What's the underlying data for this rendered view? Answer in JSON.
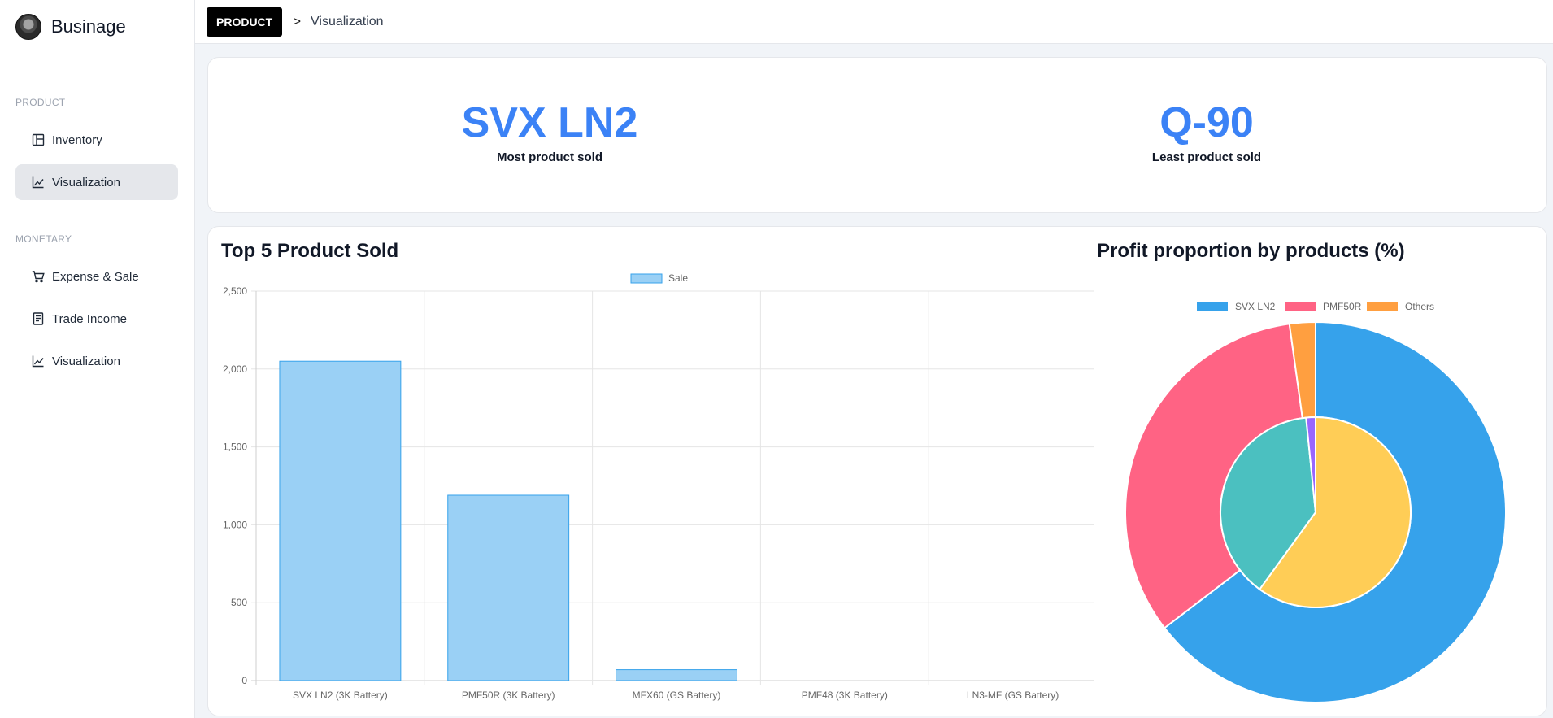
{
  "brand": {
    "name": "Businage"
  },
  "sidebar": {
    "sections": [
      {
        "label": "PRODUCT",
        "items": [
          {
            "label": "Inventory",
            "icon": "layout-icon",
            "active": false
          },
          {
            "label": "Visualization",
            "icon": "line-chart-icon",
            "active": true
          }
        ]
      },
      {
        "label": "MONETARY",
        "items": [
          {
            "label": "Expense & Sale",
            "icon": "cart-icon",
            "active": false
          },
          {
            "label": "Trade Income",
            "icon": "receipt-icon",
            "active": false
          },
          {
            "label": "Visualization",
            "icon": "line-chart-icon",
            "active": false
          }
        ]
      }
    ]
  },
  "breadcrumb": {
    "section": "PRODUCT",
    "separator": ">",
    "current": "Visualization"
  },
  "stats": {
    "most": {
      "value": "SVX LN2",
      "label": "Most product sold"
    },
    "least": {
      "value": "Q-90",
      "label": "Least product sold"
    }
  },
  "colors": {
    "accent": "#3b82f6",
    "bar_fill": "#9ad0f5",
    "bar_stroke": "#36a2eb"
  },
  "chart_data": [
    {
      "type": "bar",
      "title": "Top 5 Product Sold",
      "categories": [
        "SVX LN2 (3K Battery)",
        "PMF50R (3K Battery)",
        "MFX60 (GS Battery)",
        "PMF48 (3K Battery)",
        "LN3-MF (GS Battery)"
      ],
      "series": [
        {
          "name": "Sale",
          "values": [
            2050,
            1190,
            70,
            0,
            0
          ]
        }
      ],
      "ylim": [
        0,
        2500
      ],
      "yticks": [
        "0",
        "500",
        "1,000",
        "1,500",
        "2,000",
        "2,500"
      ],
      "legend": "top",
      "grid": true
    },
    {
      "type": "pie",
      "title": "Profit proportion by products (%)",
      "legend": "top",
      "legend_entries": [
        {
          "name": "SVX LN2",
          "color": "#36a2eb"
        },
        {
          "name": "PMF50R",
          "color": "#ff6384"
        },
        {
          "name": "Others",
          "color": "#ff9f40"
        }
      ],
      "rings": [
        {
          "ring": "outer",
          "slices": [
            {
              "name": "SVX LN2",
              "value": 64.6,
              "color": "#36a2eb"
            },
            {
              "name": "PMF50R",
              "value": 33.2,
              "color": "#ff6384"
            },
            {
              "name": "Others",
              "value": 2.2,
              "color": "#ff9f40"
            }
          ]
        },
        {
          "ring": "inner",
          "slices": [
            {
              "value": 60.0,
              "color": "#ffcd56"
            },
            {
              "value": 38.4,
              "color": "#4bc0c0"
            },
            {
              "value": 1.6,
              "color": "#9966ff"
            }
          ]
        }
      ]
    }
  ]
}
